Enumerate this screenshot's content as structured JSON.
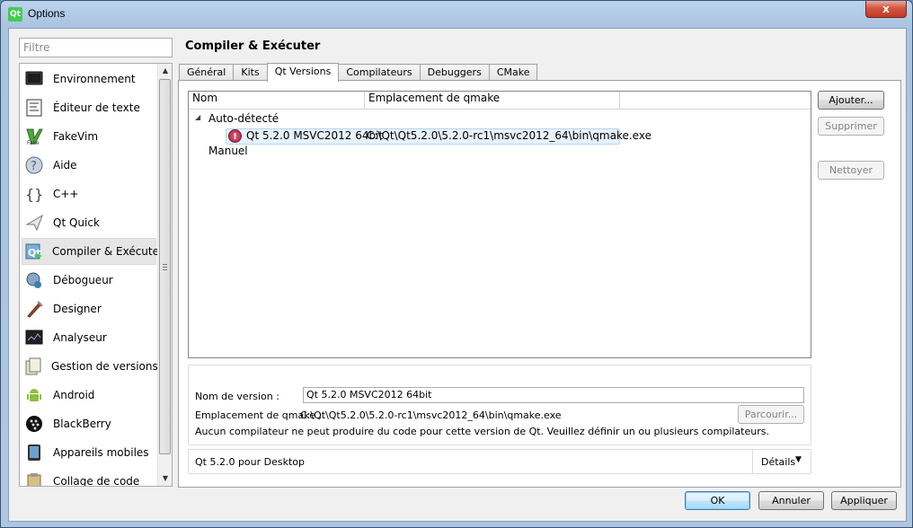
{
  "window": {
    "title": "Options",
    "app_icon": "qt-logo-icon",
    "close_label": "x"
  },
  "filter": {
    "placeholder": "Filtre"
  },
  "categories": [
    {
      "label": "Environnement",
      "icon": "monitor-icon"
    },
    {
      "label": "Éditeur de texte",
      "icon": "text-editor-icon"
    },
    {
      "label": "FakeVim",
      "icon": "fakevim-icon"
    },
    {
      "label": "Aide",
      "icon": "help-icon"
    },
    {
      "label": "C++",
      "icon": "cpp-braces-icon"
    },
    {
      "label": "Qt Quick",
      "icon": "qt-quick-icon"
    },
    {
      "label": "Compiler & Exécuter",
      "icon": "build-run-icon",
      "selected": true
    },
    {
      "label": "Débogueur",
      "icon": "debugger-icon"
    },
    {
      "label": "Designer",
      "icon": "designer-icon"
    },
    {
      "label": "Analyseur",
      "icon": "analyzer-icon"
    },
    {
      "label": "Gestion de versions",
      "icon": "version-control-icon"
    },
    {
      "label": "Android",
      "icon": "android-icon"
    },
    {
      "label": "BlackBerry",
      "icon": "blackberry-icon"
    },
    {
      "label": "Appareils mobiles",
      "icon": "mobile-device-icon"
    },
    {
      "label": "Collage de code",
      "icon": "code-paste-icon"
    }
  ],
  "page": {
    "title": "Compiler & Exécuter",
    "tabs": [
      "Général",
      "Kits",
      "Qt Versions",
      "Compilateurs",
      "Debuggers",
      "CMake"
    ],
    "active_tab": "Qt Versions"
  },
  "tree": {
    "columns": [
      "Nom",
      "Emplacement de qmake"
    ],
    "groups": [
      {
        "label": "Auto-détecté",
        "items": [
          {
            "name": "Qt 5.2.0 MSVC2012 64bit",
            "path": "C:\\Qt\\Qt5.2.0\\5.2.0-rc1\\msvc2012_64\\bin\\qmake.exe",
            "status": "error"
          }
        ]
      },
      {
        "label": "Manuel",
        "items": []
      }
    ]
  },
  "side_buttons": {
    "add": "Ajouter...",
    "remove": "Supprimer",
    "clean": "Nettoyer"
  },
  "details": {
    "version_name_label": "Nom de version :",
    "version_name_value": "Qt 5.2.0 MSVC2012 64bit",
    "qmake_location_label": "Emplacement de qmake :",
    "qmake_location_value": "C:\\Qt\\Qt5.2.0\\5.2.0-rc1\\msvc2012_64\\bin\\qmake.exe",
    "browse_label": "Parcourir...",
    "warning": "Aucun compilateur ne peut produire du code pour cette version de Qt. Veuillez définir un ou plusieurs compilateurs."
  },
  "summary": {
    "text": "Qt 5.2.0 pour Desktop",
    "details_label": "Détails"
  },
  "dialog_buttons": {
    "ok": "OK",
    "cancel": "Annuler",
    "apply": "Appliquer"
  }
}
